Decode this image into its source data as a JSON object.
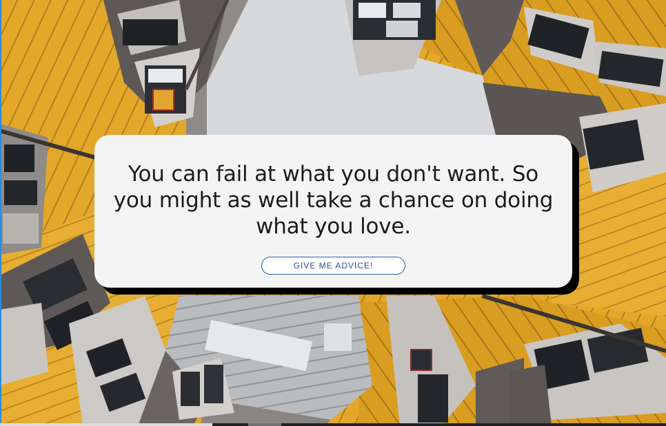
{
  "background": {
    "description_icon": "cube-houses-photo",
    "colors": {
      "yellow": "#e5a92c",
      "dark_gray": "#5a5553",
      "light_gray": "#c9c6c2",
      "window": "#22262a",
      "sky": "#dcdfe2"
    }
  },
  "quote": {
    "text": "You can fail at what you don't want. So you might as well take a chance on doing what you love."
  },
  "button": {
    "label": "GIVE ME ADVICE!",
    "border_color": "#2b5fb3"
  },
  "card": {
    "background": "#f4f4f4",
    "shadow_color": "#000000"
  }
}
